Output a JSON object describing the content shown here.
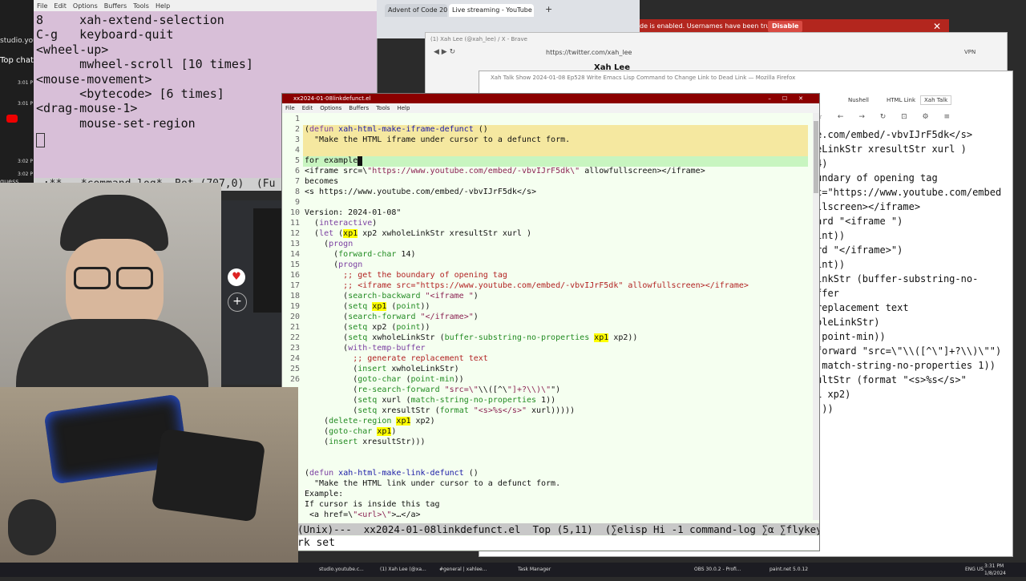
{
  "colors": {
    "emacs_bg": "#f5fff0",
    "highlight_region": "#f5e8a0",
    "yellow_match": "#ffff00",
    "comment": "#b22222",
    "string": "#8b2252",
    "keyword": "#7a3ea1",
    "function": "#1a1aa6",
    "builtin": "#228b22",
    "cmdlog_bg": "#d8bfd8",
    "banner": "#b3261e"
  },
  "left_panel": {
    "items": [
      "studio.youtu",
      "Top chat",
      "3:01 P",
      "3:01 P",
      "3:02 P",
      "3:02 P",
      "guess"
    ]
  },
  "command_log": {
    "menu": [
      "File",
      "Edit",
      "Options",
      "Buffers",
      "Tools",
      "Help"
    ],
    "lines": [
      "8     xah-extend-selection",
      "C-g   keyboard-quit",
      "<wheel-up>",
      "      mwheel-scroll [10 times]",
      "<mouse-movement>",
      "      <bytecode> [6 times]",
      "<drag-mouse-1>",
      "      mouse-set-region"
    ],
    "status": "-:**-  *command-log*  Bot (707,0)  (Fu"
  },
  "browser": {
    "tabs": [
      "Advent of Code 202",
      "Live streaming - YouTube S"
    ],
    "banner_text": "de is enabled. Usernames have been truncated.",
    "disable_label": "Disable",
    "brave_title": "(1) Xah Lee (@xah_lee) / X - Brave",
    "brave_url": "https://twitter.com/xah_lee",
    "profile_name": "Xah Lee",
    "vpn": "VPN"
  },
  "firefox": {
    "title": "Xah Talk Show 2024-01-08 Ep528 Write Emacs Lisp Command to Change Link to Dead Link — Mozilla Firefox",
    "tabs": [
      "Nushell",
      "HTML Link",
      "Xah Talk"
    ],
    "content_lines": [
      "e.com/embed/-vbvIJrF5dk</s>",
      "",
      "",
      "",
      "eLinkStr xresultStr xurl )",
      "",
      "4)",
      "",
      "",
      "undary of opening tag",
      "c=\"https://www.youtube.com/embed",
      "llscreen></iframe>",
      "ard \"<iframe \")",
      "int))",
      "rd \"</iframe>\")",
      "int))",
      "inkStr (buffer-substring-no-",
      "",
      "ffer",
      "replacement text",
      "oleLinkStr)",
      "(point-min))",
      "forward \"src=\\\"\\\\([^\\\"]+?\\\\)\\\"\")",
      "(match-string-no-properties 1))",
      "ultStr (format \"<s>%s</s>\"",
      "",
      "1 xp2)",
      "",
      "",
      ")))"
    ]
  },
  "emacs": {
    "title": "xx2024-01-08linkdefunct.el",
    "menu": [
      "File",
      "Edit",
      "Options",
      "Buffers",
      "Tools",
      "Help"
    ],
    "code": [
      {
        "n": "1",
        "t": ""
      },
      {
        "n": "2",
        "t": "(defun xah-html-make-iframe-defunct ()"
      },
      {
        "n": "3",
        "t": "  \"Make the HTML iframe under cursor to a defunct form."
      },
      {
        "n": "4",
        "t": ""
      },
      {
        "n": "5",
        "t": "for example"
      },
      {
        "n": "6",
        "t": "<iframe src=\\\"https://www.youtube.com/embed/-vbvIJrF5dk\\\" allowfullscreen></iframe>"
      },
      {
        "n": "7",
        "t": "becomes"
      },
      {
        "n": "8",
        "t": "<s https://www.youtube.com/embed/-vbvIJrF5dk</s>"
      },
      {
        "n": "9",
        "t": ""
      },
      {
        "n": "10",
        "t": "Version: 2024-01-08\""
      },
      {
        "n": "11",
        "t": "  (interactive)"
      },
      {
        "n": "12",
        "t": "  (let (xp1 xp2 xwholeLinkStr xresultStr xurl )"
      },
      {
        "n": "13",
        "t": "    (progn"
      },
      {
        "n": "14",
        "t": "      (forward-char 14)"
      },
      {
        "n": "15",
        "t": "      (progn"
      },
      {
        "n": "16",
        "t": "        ;; get the boundary of opening tag"
      },
      {
        "n": "17",
        "t": "        ;; <iframe src=\"https://www.youtube.com/embed/-vbvIJrF5dk\" allowfullscreen></iframe>"
      },
      {
        "n": "18",
        "t": "        (search-backward \"<iframe \")"
      },
      {
        "n": "19",
        "t": "        (setq xp1 (point))"
      },
      {
        "n": "20",
        "t": "        (search-forward \"</iframe>\")"
      },
      {
        "n": "21",
        "t": "        (setq xp2 (point))"
      },
      {
        "n": "22",
        "t": "        (setq xwholeLinkStr (buffer-substring-no-properties xp1 xp2))"
      },
      {
        "n": "23",
        "t": "        (with-temp-buffer"
      },
      {
        "n": "24",
        "t": "          ;; generate replacement text"
      },
      {
        "n": "25",
        "t": "          (insert xwholeLinkStr)"
      },
      {
        "n": "26",
        "t": "          (goto-char (point-min))"
      },
      {
        "n": "",
        "t": "          (re-search-forward \"src=\\\"\\\\([^\\\"]+?\\\\)\\\"\")"
      },
      {
        "n": "",
        "t": "          (setq xurl (match-string-no-properties 1))"
      },
      {
        "n": "",
        "t": "          (setq xresultStr (format \"<s>%s</s>\" xurl)))))"
      },
      {
        "n": "",
        "t": "    (delete-region xp1 xp2)"
      },
      {
        "n": "",
        "t": "    (goto-char xp1)"
      },
      {
        "n": "",
        "t": "    (insert xresultStr)))"
      },
      {
        "n": "",
        "t": ""
      },
      {
        "n": "",
        "t": ""
      },
      {
        "n": "",
        "t": "(defun xah-html-make-link-defunct ()"
      },
      {
        "n": "",
        "t": "  \"Make the HTML link under cursor to a defunct form."
      },
      {
        "n": "",
        "t": "Example:"
      },
      {
        "n": "",
        "t": "If cursor is inside this tag"
      },
      {
        "n": "",
        "t": " <a href=\\\"<url>\\\">…</a>"
      }
    ],
    "modeline": "(Unix)---  xx2024-01-08linkdefunct.el  Top (5,11)  (∑elisp Hi -1 command-log ∑α ∑flykeys A",
    "minibuffer": "rk set"
  },
  "taskbar": {
    "items": [
      "studio.youtube.c...",
      "(1) Xah Lee (@xa...",
      "#general | xahlee...",
      "Task Manager",
      "OBS 30.0.2 - Profi...",
      "paint.net 5.0.12"
    ],
    "lang": "ENG US",
    "time": "3:31 PM",
    "date": "1/8/2024"
  }
}
